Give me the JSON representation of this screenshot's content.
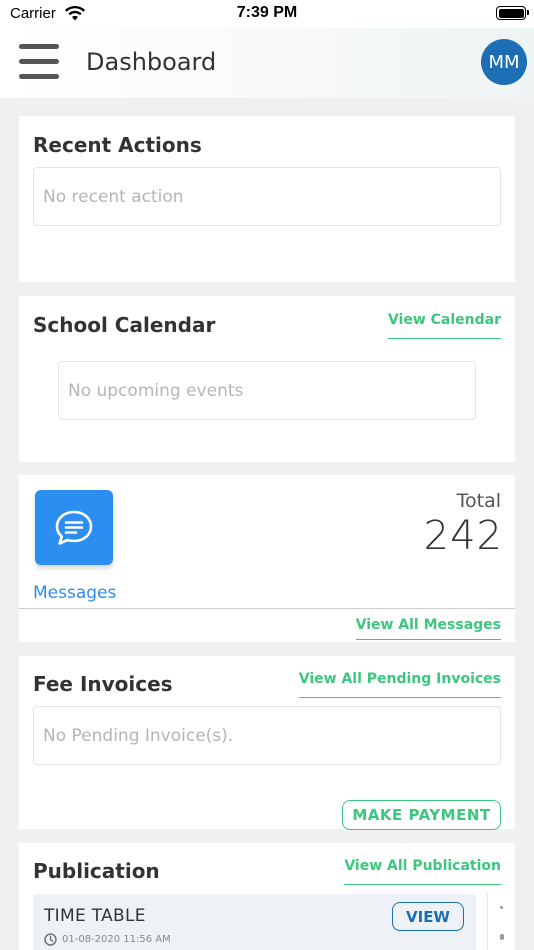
{
  "status_bar": {
    "carrier": "Carrier",
    "time": "7:39 PM"
  },
  "header": {
    "title": "Dashboard",
    "avatar_initials": "MM",
    "avatar_color": "#1c6fb3"
  },
  "recent_actions": {
    "title": "Recent Actions",
    "empty_text": "No recent action"
  },
  "school_calendar": {
    "title": "School Calendar",
    "link_label": "View Calendar",
    "empty_text": "No upcoming events"
  },
  "messages": {
    "label": "Messages",
    "total_label": "Total",
    "total_value": "242",
    "link_label": "View All Messages",
    "tile_color": "#2b8ef0"
  },
  "fee_invoices": {
    "title": "Fee Invoices",
    "link_label": "View All Pending Invoices",
    "empty_text": "No Pending Invoice(s).",
    "pay_button_label": "MAKE PAYMENT"
  },
  "publication": {
    "title": "Publication",
    "link_label": "View All Publication",
    "items": [
      {
        "title": "TIME TABLE",
        "date": "01-08-2020 11:56 AM",
        "view_label": "VIEW"
      }
    ]
  },
  "colors": {
    "accent_green": "#3bc77f",
    "accent_blue": "#1c6fb3"
  }
}
